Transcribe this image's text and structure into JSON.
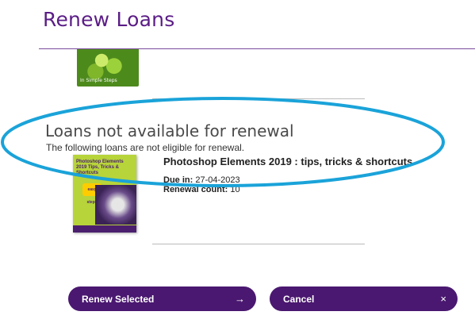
{
  "page": {
    "title": "Renew Loans"
  },
  "previous_cover": {
    "logo_text": "In Simple Steps"
  },
  "unavailable_section": {
    "heading": "Loans not available for renewal",
    "description": "The following loans are not eligible for renewal.",
    "items": [
      {
        "cover_title": "Photoshop Elements 2019 Tips, Tricks & Shortcuts",
        "cover_badge": "easy steps",
        "title": "Photoshop Elements 2019 : tips, tricks & shortcuts",
        "due_label": "Due in:",
        "due_value": "27-04-2023",
        "renewal_label": "Renewal count:",
        "renewal_value": "10"
      }
    ]
  },
  "buttons": {
    "renew_label": "Renew Selected",
    "renew_icon": "arrow-right-icon",
    "cancel_label": "Cancel",
    "cancel_icon": "close-icon"
  },
  "colors": {
    "title": "#5b1d86",
    "button_bg": "#4a1870",
    "highlight_ellipse": "#1aa3d9"
  }
}
